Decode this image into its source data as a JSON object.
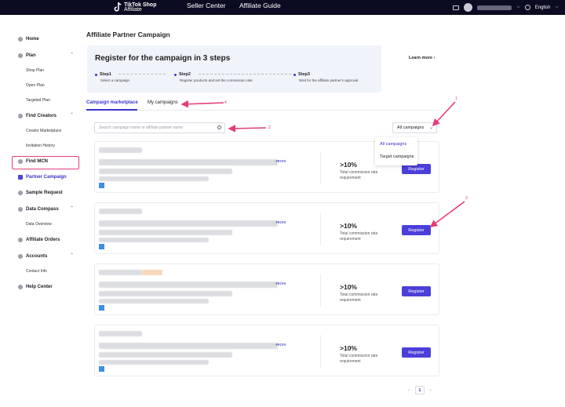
{
  "topbar": {
    "logo_line1": "TikTok Shop",
    "logo_line2": "Affiliate",
    "nav": [
      "Seller Center",
      "Affiliate Guide"
    ],
    "language": "English"
  },
  "sidebar": {
    "items": [
      {
        "label": "Home"
      },
      {
        "label": "Plan",
        "subs": [
          "Shop Plan",
          "Open Plan",
          "Targeted Plan"
        ]
      },
      {
        "label": "Find Creators",
        "subs": [
          "Creator Marketplace",
          "Invitation History"
        ]
      },
      {
        "label": "Find MCN"
      },
      {
        "label": "Partner Campaign"
      },
      {
        "label": "Sample Request"
      },
      {
        "label": "Data Compass",
        "subs": [
          "Data Overview"
        ]
      },
      {
        "label": "Affiliate Orders"
      },
      {
        "label": "Accounts",
        "subs": [
          "Contact Info"
        ]
      },
      {
        "label": "Help Center"
      }
    ]
  },
  "page": {
    "title": "Affiliate Partner Campaign",
    "steps_title": "Register for the campaign in 3 steps",
    "learn_more": "Learn more",
    "steps": [
      {
        "title": "Step1",
        "desc": "Select a campaign"
      },
      {
        "title": "Step2",
        "desc": "Register products and set the commission rate"
      },
      {
        "title": "Step3",
        "desc": "Wait for the affiliate partner's approval"
      }
    ],
    "tabs": [
      "Campaign marketplace",
      "My campaigns"
    ],
    "search_placeholder": "Search campaign name or affiliate partner name",
    "filter_selected": "All campaigns",
    "filter_options": [
      "All campaigns",
      "Target campaigns"
    ]
  },
  "cards": [
    {
      "more": "more",
      "rate": ">10%",
      "rate_desc": "Total commission rate requirement",
      "button": "Register"
    },
    {
      "more": "more",
      "rate": ">10%",
      "rate_desc": "Total commission rate requirement",
      "button": "Register"
    },
    {
      "more": "more",
      "rate": ">10%",
      "rate_desc": "Total commission rate requirement",
      "button": "Register"
    },
    {
      "more": "more",
      "rate": ">10%",
      "rate_desc": "Total commission rate requirement",
      "button": "Register"
    }
  ],
  "pagination": {
    "current": "1"
  },
  "annotations": [
    "1",
    "2",
    "3",
    "4"
  ],
  "colors": {
    "accent": "#4b3fd9",
    "annotation": "#e63b7a",
    "topbar": "#0b0b22"
  }
}
